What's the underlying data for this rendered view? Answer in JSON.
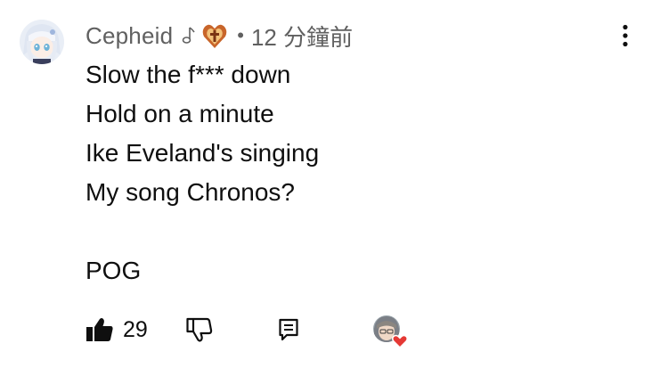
{
  "comment": {
    "author": "Cepheid",
    "separator": "•",
    "timestamp": "12 分鐘前",
    "badges": {
      "note_icon": "music-note-icon",
      "member_icon": "member-badge-icon"
    },
    "lines": [
      "Slow the f*** down",
      "Hold on a minute",
      "Ike Eveland's singing",
      "My song Chronos?",
      "",
      "POG"
    ],
    "like_count": "29"
  },
  "colors": {
    "text": "#0f0f0f",
    "secondary": "#606060",
    "heart": "#e53935",
    "badge_orange": "#c8652a"
  },
  "icons": {
    "menu": "more-vertical-icon",
    "like": "thumbs-up-icon",
    "dislike": "thumbs-down-icon",
    "reply": "reply-icon",
    "creator_heart": "creator-heart-icon"
  }
}
